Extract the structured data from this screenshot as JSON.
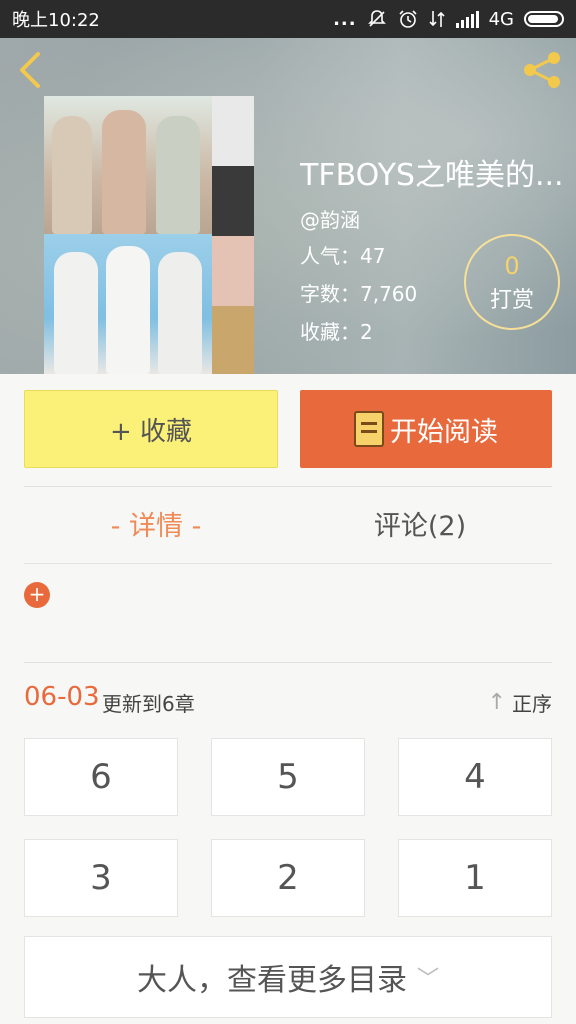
{
  "status_bar": {
    "time": "晚上10:22",
    "network": "4G",
    "dots": "..."
  },
  "book": {
    "title": "TFBOYS之唯美的...",
    "author": "@韵涵",
    "popularity": "人气：47",
    "word_count": "字数：7,760",
    "favorites": "收藏：2"
  },
  "tip": {
    "count": "0",
    "label": "打赏"
  },
  "actions": {
    "favorite_label": "+ 收藏",
    "read_label": "开始阅读"
  },
  "tabs": {
    "detail_label": "- 详情 -",
    "comments_label": "评论(2)"
  },
  "plus_badge": "+",
  "update": {
    "date": "06-03",
    "text": "更新到6章",
    "sort_label": "正序",
    "sort_arrow": "↑"
  },
  "chapters": [
    "6",
    "5",
    "4",
    "3",
    "2",
    "1"
  ],
  "more_label": "大人，查看更多目录",
  "more_chevron": "﹀",
  "colors": {
    "accent": "#e8693b",
    "favorite_bg": "#fbf178",
    "tab_active": "#f08a57",
    "tip_count": "#f7d26a"
  },
  "icons": [
    "back-icon",
    "share-icon",
    "mute-icon",
    "alarm-icon",
    "data-icon",
    "signal-icon",
    "battery-icon",
    "book-icon",
    "up-arrow-icon",
    "chevron-down-icon"
  ]
}
